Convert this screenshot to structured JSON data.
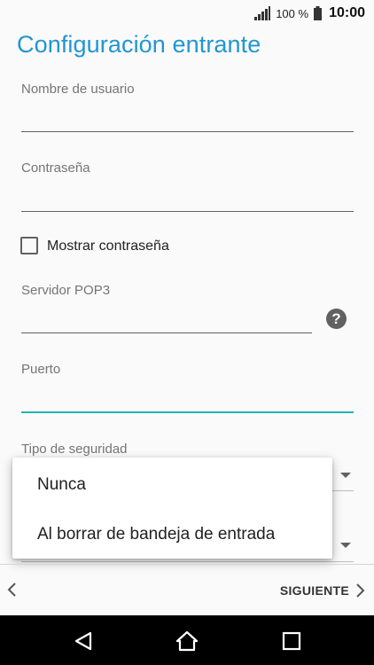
{
  "status_bar": {
    "battery_percent": "100 %",
    "time": "10:00"
  },
  "page": {
    "title": "Configuración entrante"
  },
  "fields": {
    "username_label": "Nombre de usuario",
    "password_label": "Contraseña",
    "show_password_label": "Mostrar contraseña",
    "server_label": "Servidor POP3",
    "port_label": "Puerto",
    "security_label": "Tipo de seguridad"
  },
  "popup": {
    "options": [
      "Nunca",
      "Al borrar de bandeja de entrada"
    ]
  },
  "footer": {
    "next_label": "SIGUIENTE"
  },
  "colors": {
    "accent": "#2196d3",
    "active_underline": "#26b3b3"
  }
}
